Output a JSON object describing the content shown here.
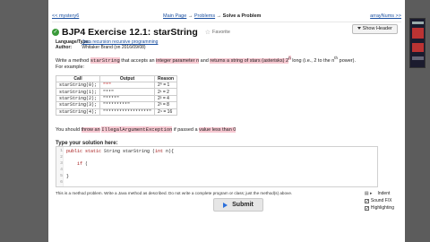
{
  "nav": {
    "prev": "<< mystery6",
    "crumbs": {
      "main": "Main Page",
      "problems": "Problems",
      "current": "Solve a Problem"
    },
    "next": "arrayNums >>"
  },
  "problem": {
    "title": "BJP4 Exercise 12.1: starString",
    "favorite": "Favorite",
    "show_header": "Show Header",
    "language_label": "Language/Type:",
    "language_value": "Java recursion recursive programming",
    "author_label": "Author:",
    "author_value": "Whitaker Brand (on 2016/09/08)",
    "desc_1": "Write a method",
    "desc_method": "starString",
    "desc_2": "that accepts an",
    "desc_hl1": "integer parameter n",
    "desc_3": "and",
    "desc_hl2": "returns a string of stars (asterisks) 2",
    "desc_4": "long (i.e., 2 to the n",
    "desc_5": "power). For example:",
    "sup_n": "n",
    "sup_th": "th"
  },
  "table": {
    "headers": [
      "Call",
      "Output",
      "Reason"
    ],
    "rows": [
      {
        "call": "starString(0);",
        "output": "\"*\"",
        "reason": "2⁰ = 1"
      },
      {
        "call": "starString(1);",
        "output": "\"**\"",
        "reason": "2¹ = 2"
      },
      {
        "call": "starString(2);",
        "output": "\"****\"",
        "reason": "2² = 4"
      },
      {
        "call": "starString(3);",
        "output": "\"********\"",
        "reason": "2³ = 8"
      },
      {
        "call": "starString(4);",
        "output": "\"****************\"",
        "reason": "2⁴ = 16"
      }
    ]
  },
  "exception": {
    "pre": "You should",
    "hl": "throw an",
    "code": "IllegalArgumentException",
    "mid": "if passed a",
    "hl2": "value less than 0"
  },
  "solution": {
    "heading": "Type your solution here:",
    "lines": [
      {
        "num": "1",
        "text": "public static String starString (int n){"
      },
      {
        "num": "2",
        "text": ""
      },
      {
        "num": "3",
        "text": "    if ("
      },
      {
        "num": "4",
        "text": ""
      },
      {
        "num": "5",
        "text": "}"
      },
      {
        "num": "6",
        "text": ""
      }
    ]
  },
  "note": "This is a method problem. Write a Java method as described. Do not write a complete program or class; just the method(s) above.",
  "submit_label": "Submit",
  "options": {
    "indent": "Indent",
    "sound": "Sound F/X",
    "highlighting": "Highlighting"
  },
  "colors": {
    "highlight": "#f7c9d2",
    "link": "#1a4fa0",
    "check": "#3a9a3a",
    "sidebar": "#5f5f5f"
  }
}
